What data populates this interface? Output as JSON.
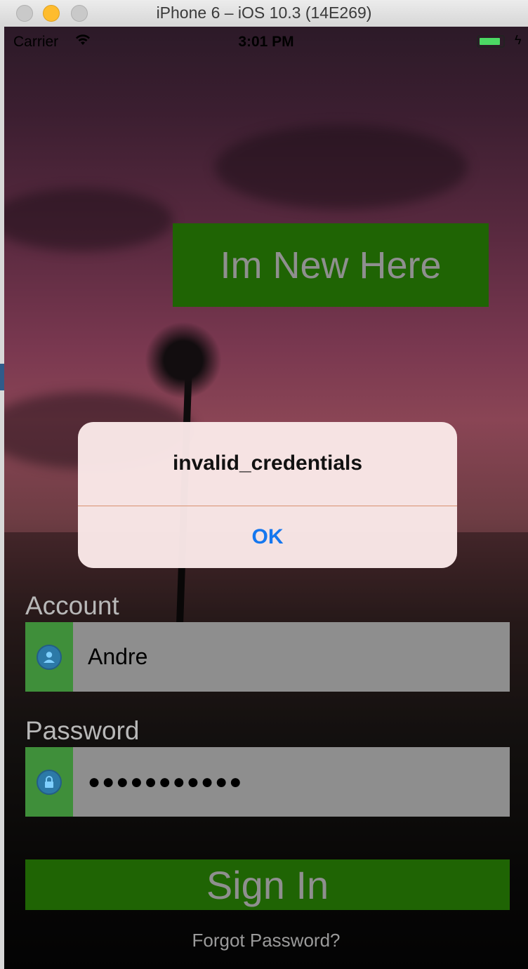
{
  "window": {
    "title": "iPhone 6 – iOS 10.3 (14E269)"
  },
  "status_bar": {
    "carrier": "Carrier",
    "time": "3:01 PM"
  },
  "new_here_label": "Im New Here",
  "alert": {
    "message": "invalid_credentials",
    "ok_label": "OK"
  },
  "account": {
    "label": "Account",
    "value": "Andre",
    "icon": "user-icon"
  },
  "password": {
    "label": "Password",
    "value": "●●●●●●●●●●●",
    "icon": "lock-icon"
  },
  "sign_in_label": "Sign In",
  "forgot_password_label": "Forgot Password?",
  "colors": {
    "button_green": "#1f6404",
    "icon_green": "#3f8f3a",
    "field_gray": "#8e8e8e",
    "alert_button_blue": "#1577ef"
  }
}
